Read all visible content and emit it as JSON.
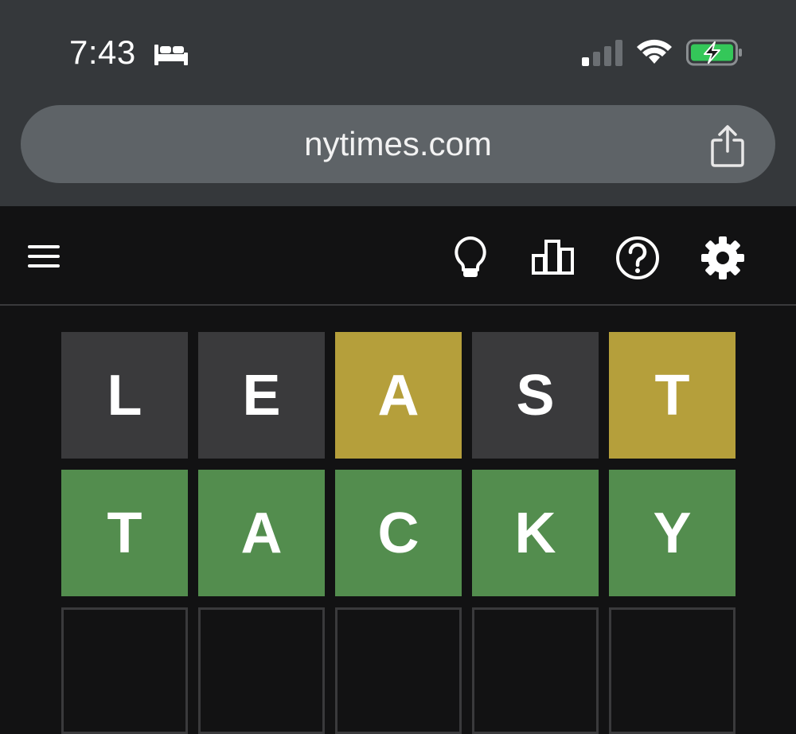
{
  "status_bar": {
    "time": "7:43",
    "icons": [
      "bed-icon",
      "cellular-signal-icon",
      "wifi-icon",
      "battery-charging-icon"
    ],
    "battery_color": "#34c759"
  },
  "browser": {
    "url": "nytimes.com",
    "share_icon": "share-icon"
  },
  "game_header": {
    "icons": [
      "menu-icon",
      "lightbulb-icon",
      "stats-icon",
      "help-icon",
      "gear-icon"
    ]
  },
  "colors": {
    "absent": "#3a3a3c",
    "present": "#b59f3b",
    "correct": "#538d4e",
    "background": "#121213"
  },
  "board": {
    "rows": [
      {
        "tiles": [
          {
            "letter": "L",
            "state": "absent"
          },
          {
            "letter": "E",
            "state": "absent"
          },
          {
            "letter": "A",
            "state": "present"
          },
          {
            "letter": "S",
            "state": "absent"
          },
          {
            "letter": "T",
            "state": "present"
          }
        ]
      },
      {
        "tiles": [
          {
            "letter": "T",
            "state": "correct"
          },
          {
            "letter": "A",
            "state": "correct"
          },
          {
            "letter": "C",
            "state": "correct"
          },
          {
            "letter": "K",
            "state": "correct"
          },
          {
            "letter": "Y",
            "state": "correct"
          }
        ]
      },
      {
        "tiles": [
          {
            "letter": "",
            "state": "empty"
          },
          {
            "letter": "",
            "state": "empty"
          },
          {
            "letter": "",
            "state": "empty"
          },
          {
            "letter": "",
            "state": "empty"
          },
          {
            "letter": "",
            "state": "empty"
          }
        ]
      }
    ]
  }
}
